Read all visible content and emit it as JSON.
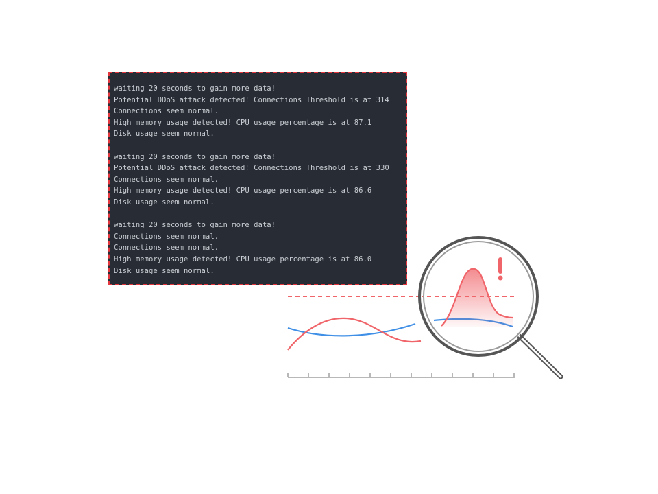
{
  "terminal": {
    "lines": [
      "waiting 20 seconds to gain more data!",
      "Potential DDoS attack detected! Connections Threshold is at 314",
      "Connections seem normal.",
      "High memory usage detected! CPU usage percentage is at 87.1",
      "Disk usage seem normal.",
      "",
      "waiting 20 seconds to gain more data!",
      "Potential DDoS attack detected! Connections Threshold is at 330",
      "Connections seem normal.",
      "High memory usage detected! CPU usage percentage is at 86.6",
      "Disk usage seem normal.",
      "",
      "waiting 20 seconds to gain more data!",
      "Connections seem normal.",
      "Connections seem normal.",
      "High memory usage detected! CPU usage percentage is at 86.0",
      "Disk usage seem normal."
    ]
  },
  "illustration": {
    "alert_symbol": "!",
    "colors": {
      "terminal_bg": "#282c34",
      "terminal_text": "#c7cbd1",
      "terminal_border": "#e5353d",
      "red_series": "#f0656a",
      "blue_series": "#3f8fe6",
      "threshold": "#f0656a",
      "magnifier": "#555555",
      "axis": "#b8b8b8"
    },
    "icons": [
      "magnifying-glass-icon",
      "exclamation-icon"
    ]
  }
}
